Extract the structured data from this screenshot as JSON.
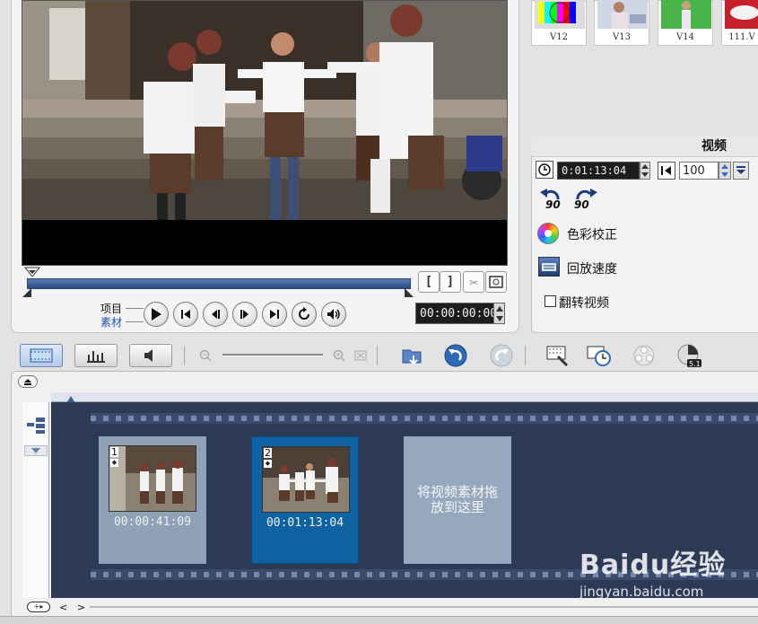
{
  "library": {
    "thumbnails": [
      {
        "label": "V12"
      },
      {
        "label": "V13"
      },
      {
        "label": "V14"
      },
      {
        "label": "111.V"
      }
    ]
  },
  "preview": {
    "mode_project": "项目",
    "mode_clip": "素材",
    "timecode": "00:00:00:00",
    "mark_in_label": "[",
    "mark_out_label": "]"
  },
  "options": {
    "tab_title": "视频",
    "duration": "0:01:13:04",
    "volume": "100",
    "rotate_left_label": "90",
    "rotate_right_label": "90",
    "color_correction": "色彩校正",
    "playback_speed": "回放速度",
    "reverse_video": "翻转视频",
    "reverse_checked": false
  },
  "storyboard": {
    "clips": [
      {
        "number": "1",
        "time": "00:00:41:09",
        "selected": false
      },
      {
        "number": "2",
        "time": "00:01:13:04",
        "selected": true
      }
    ],
    "drop_text": "将视频素材拖放到这里"
  },
  "watermark": {
    "logo": "Baidu经验",
    "url": "jingyan.baidu.com"
  },
  "colors": {
    "scrub_track": "#3b5f96",
    "storyboard_bg": "#2c3a56",
    "clip_selected": "#0f63a3",
    "clip_normal": "#8fa1b7"
  }
}
